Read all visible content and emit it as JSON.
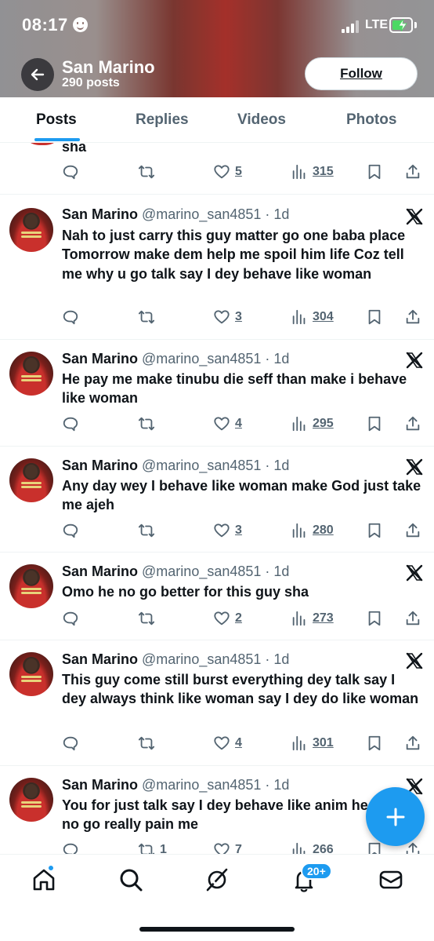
{
  "status_bar": {
    "time": "08:17",
    "network": "LTE"
  },
  "profile": {
    "name": "San Marino",
    "post_count": "290 posts",
    "follow_label": "Follow"
  },
  "tabs": [
    {
      "label": "Posts",
      "active": true
    },
    {
      "label": "Replies",
      "active": false
    },
    {
      "label": "Videos",
      "active": false
    },
    {
      "label": "Photos",
      "active": false
    }
  ],
  "partial_post": {
    "text": "sha",
    "likes": "5",
    "views": "315"
  },
  "posts": [
    {
      "name": "San Marino",
      "handle": "@marino_san4851",
      "time": "· 1d",
      "text": "Nah to just carry this guy matter go one baba place Tomorrow make dem help me spoil him life Coz tell me why u go talk say I dey behave like woman",
      "retweets": "",
      "likes": "3",
      "views": "304"
    },
    {
      "name": "San Marino",
      "handle": "@marino_san4851",
      "time": "· 1d",
      "text": "He pay me make tinubu die seff than make i behave like woman",
      "retweets": "",
      "likes": "4",
      "views": "295"
    },
    {
      "name": "San Marino",
      "handle": "@marino_san4851",
      "time": "· 1d",
      "text": "Any day wey I behave like woman make God just take me ajeh",
      "retweets": "",
      "likes": "3",
      "views": "280"
    },
    {
      "name": "San Marino",
      "handle": "@marino_san4851",
      "time": "· 1d",
      "text": "Omo he no go better for this guy sha",
      "retweets": "",
      "likes": "2",
      "views": "273"
    },
    {
      "name": "San Marino",
      "handle": "@marino_san4851",
      "time": "· 1d",
      "text": "This guy come still burst everything dey talk say I dey always think like woman say I dey do like woman",
      "retweets": "",
      "likes": "4",
      "views": "301"
    },
    {
      "name": "San Marino",
      "handle": "@marino_san4851",
      "time": "· 1d",
      "text": "You for just talk say I dey behave like anim he no go really pain me",
      "retweets": "1",
      "likes": "7",
      "views": "266"
    }
  ],
  "notifications_badge": "20+",
  "colors": {
    "accent": "#1d9bf0",
    "text": "#0f1419",
    "secondary": "#536471"
  },
  "icons": [
    "back-arrow-icon",
    "x-logo-icon",
    "reply-icon",
    "retweet-icon",
    "like-icon",
    "views-icon",
    "bookmark-icon",
    "share-icon",
    "compose-icon",
    "home-icon",
    "search-icon",
    "grok-icon",
    "notifications-icon",
    "messages-icon"
  ]
}
